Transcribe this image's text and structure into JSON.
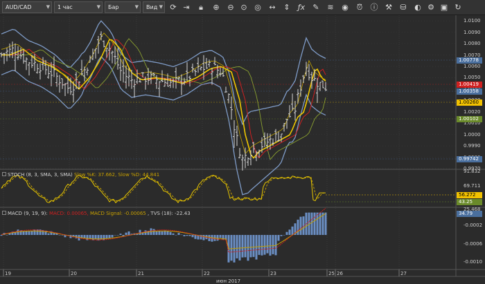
{
  "toolbar": {
    "symbol": "AUD/CAD",
    "timeframe": "1 час",
    "chart_type": "Бар",
    "view": "Вид",
    "icons": [
      "refresh-icon",
      "arrow-right-icon",
      "lock-icon",
      "zoom-in-icon",
      "zoom-out-icon",
      "zoom-fit-icon",
      "zoom-reset-icon",
      "scroll-horizontal-icon",
      "function-icon",
      "pencil-icon",
      "layers-icon",
      "eye-icon",
      "alarm-icon",
      "info-icon",
      "tools-icon",
      "bucket-icon",
      "screenshot-icon",
      "settings-icon"
    ]
  },
  "price_axis": {
    "ticks": [
      "1.0100",
      "1.0090",
      "1.0080",
      "1.0070",
      "1.0060",
      "1.0050",
      "1.0040",
      "1.0030",
      "1.0020",
      "1.0010",
      "1.0000",
      "0.9990",
      "0.9980",
      "0.9970"
    ],
    "tags": [
      {
        "text": "1.00778",
        "bg": "#4a6f9e",
        "fg": "#ffffff"
      },
      {
        "text": "1.00419",
        "bg": "#d02020",
        "fg": "#ffffff"
      },
      {
        "text": "1.00358",
        "bg": "#4a6f9e",
        "fg": "#ffffff"
      },
      {
        "text": "1.00260",
        "bg": "#f2c200",
        "fg": "#000000"
      },
      {
        "text": "1.00102",
        "bg": "#6a8a2a",
        "fg": "#ffffff"
      },
      {
        "text": "0.99742",
        "bg": "#4a6f9e",
        "fg": "#ffffff"
      }
    ]
  },
  "stoch": {
    "title": "STOCH (8, 3, SMA, 3, SMA)",
    "k_label": "Slow %K: 37.662,",
    "d_label": "Slow %D: 44.841",
    "ticks": [
      "91.832",
      "69.711",
      "47.592",
      "25.468"
    ],
    "tags": [
      {
        "text": "56.272",
        "bg": "#f2c200",
        "fg": "#000000"
      },
      {
        "text": "43.25",
        "bg": "#6a8a2a",
        "fg": "#ffffff"
      }
    ]
  },
  "macd": {
    "title": "MACD (9, 19, 9):",
    "macd_label": "MACD: 0.00065,",
    "signal_label": "MACD Signal: -0.00065",
    "tvs_label": ", TVS (18): -22.43",
    "ticks": [
      "-0.0002",
      "-0.0006",
      "-0.0010"
    ],
    "tags": [
      {
        "text": "34.79",
        "bg": "#4a6f9e",
        "fg": "#ffffff"
      }
    ]
  },
  "time_axis": {
    "dates": [
      "19",
      "20",
      "21",
      "22",
      "23",
      "25",
      "26",
      "27"
    ],
    "month": "июн 2017"
  },
  "colors": {
    "bars": "#d8d8d8",
    "bollinger": "#7f9cc8",
    "ma_yellow": "#f0c800",
    "ma_red": "#d02020",
    "ma_olive": "#8aa030",
    "grid": "#3a3a3a"
  },
  "chart_data": {
    "type": "ohlc",
    "symbol": "AUD/CAD",
    "timeframe": "1 час",
    "ylim": [
      0.997,
      1.0105
    ],
    "x": [
      "19",
      "20",
      "21",
      "22",
      "23",
      "25",
      "26",
      "27"
    ],
    "close_approx": [
      1.004,
      1.005,
      1.0045,
      1.0048,
      1.0045,
      1.005,
      1.0035,
      0.9985,
      0.999,
      1.002,
      1.0045,
      1.0042
    ],
    "last_price": 1.00419
  }
}
